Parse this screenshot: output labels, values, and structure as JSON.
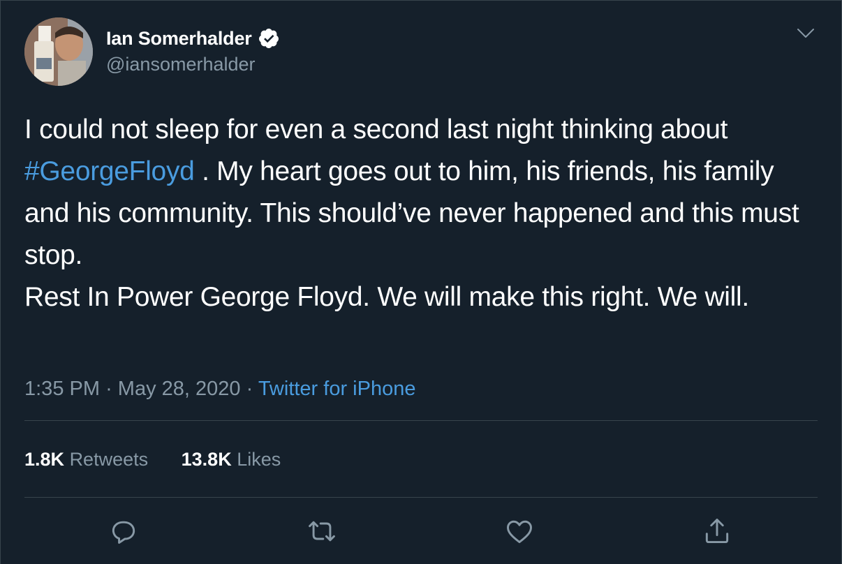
{
  "author": {
    "display_name": "Ian Somerhalder",
    "handle": "@iansomerhalder",
    "verified": true
  },
  "tweet": {
    "text_before": "I could not sleep for even a second last night thinking about ",
    "hashtag": "#GeorgeFloyd",
    "text_after": " . My heart goes out to him, his friends, his family and his community. This should’ve never happened and this must stop.",
    "text_line2": "Rest In Power George Floyd. We will make this right. We will."
  },
  "meta": {
    "time": "1:35 PM",
    "separator": "·",
    "date": "May 28, 2020",
    "source": "Twitter for iPhone"
  },
  "stats": {
    "retweets_count": "1.8K",
    "retweets_label": "Retweets",
    "likes_count": "13.8K",
    "likes_label": "Likes"
  },
  "icons": {
    "reply": "reply-icon",
    "retweet": "retweet-icon",
    "like": "heart-icon",
    "share": "share-icon",
    "more": "chevron-down-icon",
    "verified": "verified-badge-icon"
  },
  "colors": {
    "background": "#15202b",
    "accent": "#4a9cdf",
    "secondary_text": "#8899a6",
    "divider": "#38444d"
  }
}
